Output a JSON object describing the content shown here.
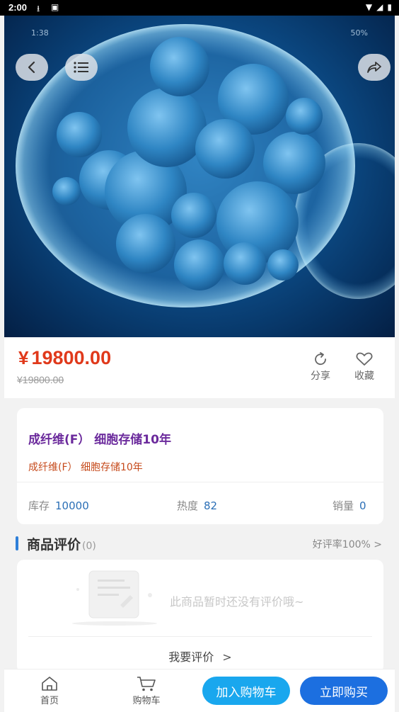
{
  "status_bar": {
    "time": "2:00"
  },
  "hero": {
    "inner_status_left": "1:38",
    "inner_status_right": "50%"
  },
  "price": {
    "currency": "¥",
    "current": "19800.00",
    "original": "¥19800.00",
    "share_label": "分享",
    "favorite_label": "收藏"
  },
  "product": {
    "title": "成纤维(F） 细胞存储10年",
    "subtitle": "成纤维(F） 细胞存储10年",
    "stock_label": "库存",
    "stock_value": "10000",
    "heat_label": "热度",
    "heat_value": "82",
    "sales_label": "销量",
    "sales_value": "0"
  },
  "reviews": {
    "title": "商品评价",
    "count": "(0)",
    "positive_rate": "好评率100%",
    "empty_text": "此商品暂时还没有评价哦~",
    "write_review": "我要评价"
  },
  "bottom_bar": {
    "home_label": "首页",
    "cart_label": "购物车",
    "add_to_cart": "加入购物车",
    "buy_now": "立即购买"
  },
  "colors": {
    "price": "#e0391b",
    "title": "#6b2a9c",
    "accent_blue": "#1c6fe0",
    "cart_button": "#19a7ee"
  }
}
